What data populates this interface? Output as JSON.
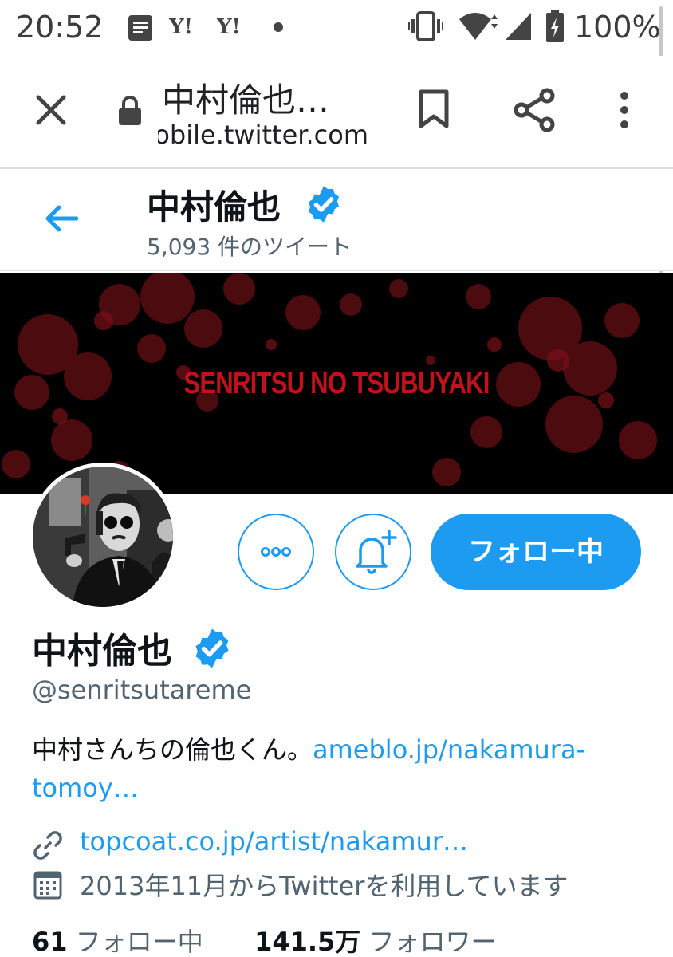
{
  "status_bar": {
    "time": "20:52",
    "notification_icons": [
      "news-icon",
      "yahoo-icon",
      "yahoo-icon",
      "dot-icon"
    ],
    "system_icons": [
      "vibrate-icon",
      "wifi-icon",
      "signal-icon",
      "battery-charging-icon"
    ],
    "battery": "100%"
  },
  "toolbar": {
    "page_title": "中村倫也…",
    "url": "mobile.twitter.com"
  },
  "header": {
    "name": "中村倫也",
    "tweet_count": "5,093 件のツイート"
  },
  "banner": {
    "text": "SENRITSU NO TSUBUYAKI"
  },
  "actions": {
    "follow_label": "フォロー中"
  },
  "profile": {
    "name": "中村倫也",
    "handle": "@senritsutareme",
    "bio_text": "中村さんちの倫也くん。",
    "bio_link_line1": "ameblo.jp/nakamura-",
    "bio_link_line2": "tomoy…",
    "website": "topcoat.co.jp/artist/nakamur…",
    "joined": "2013年11月からTwitterを利用しています",
    "following_count": "61",
    "following_label": "フォロー中",
    "followers_count": "141.5万",
    "followers_label": "フォロワー"
  },
  "colors": {
    "accent": "#1d9bf0",
    "banner_text": "#c0121a",
    "secondary_text": "#536471"
  }
}
